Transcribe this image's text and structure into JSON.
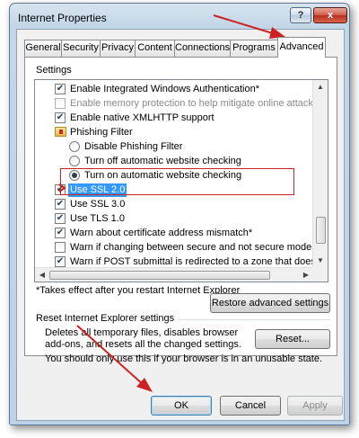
{
  "window": {
    "title": "Internet Properties",
    "help_glyph": "?",
    "close_glyph": "x"
  },
  "tabs": [
    {
      "label": "General"
    },
    {
      "label": "Security"
    },
    {
      "label": "Privacy"
    },
    {
      "label": "Content"
    },
    {
      "label": "Connections"
    },
    {
      "label": "Programs"
    },
    {
      "label": "Advanced",
      "active": true
    }
  ],
  "settings": {
    "group_label": "Settings",
    "items": [
      {
        "type": "checkbox",
        "checked": true,
        "label": "Enable Integrated Windows Authentication*"
      },
      {
        "type": "checkbox",
        "checked": false,
        "disabled": true,
        "label": "Enable memory protection to help mitigate online attacks"
      },
      {
        "type": "checkbox",
        "checked": true,
        "label": "Enable native XMLHTTP support"
      },
      {
        "type": "folder",
        "label": "Phishing Filter"
      },
      {
        "type": "radio",
        "checked": false,
        "label": "Disable Phishing Filter"
      },
      {
        "type": "radio",
        "checked": false,
        "label": "Turn off automatic website checking"
      },
      {
        "type": "radio",
        "checked": true,
        "label": "Turn on automatic website checking"
      },
      {
        "type": "checkbox",
        "checked": true,
        "selected": true,
        "label": "Use SSL 2.0"
      },
      {
        "type": "checkbox",
        "checked": true,
        "label": "Use SSL 3.0"
      },
      {
        "type": "checkbox",
        "checked": true,
        "label": "Use TLS 1.0"
      },
      {
        "type": "checkbox",
        "checked": true,
        "label": "Warn about certificate address mismatch*"
      },
      {
        "type": "checkbox",
        "checked": false,
        "label": "Warn if changing between secure and not secure mode"
      },
      {
        "type": "checkbox",
        "checked": true,
        "label": "Warn if POST submittal is redirected to a zone that does n"
      }
    ],
    "note": "*Takes effect after you restart Internet Explorer",
    "restore_button": "Restore advanced settings"
  },
  "reset": {
    "group_label": "Reset Internet Explorer settings",
    "description_line1": "Deletes all temporary files, disables browser",
    "description_line2": "add-ons, and resets all the changed settings.",
    "reset_button": "Reset...",
    "warning": "You should only use this if your browser is in an unusable state."
  },
  "footer": {
    "ok": "OK",
    "cancel": "Cancel",
    "apply": "Apply"
  },
  "colors": {
    "annotation_red": "#cc2222",
    "selection_blue": "#3399ff"
  }
}
